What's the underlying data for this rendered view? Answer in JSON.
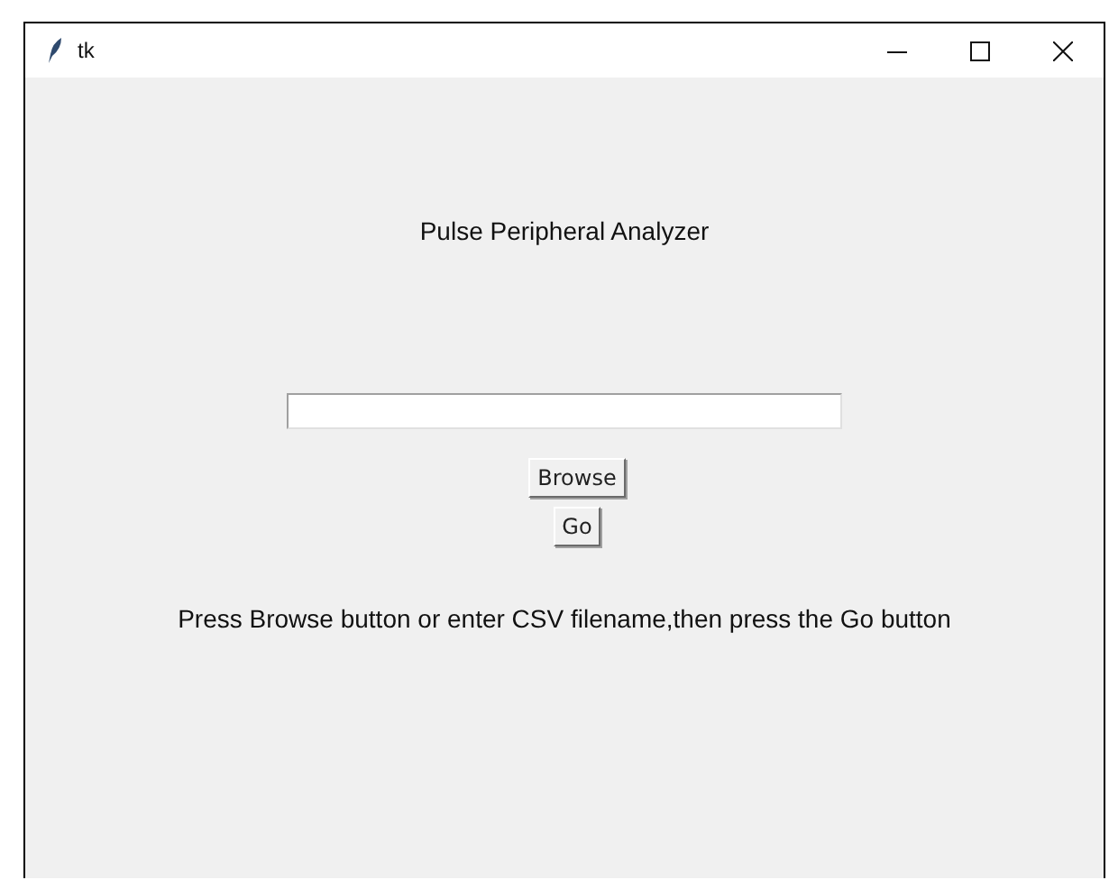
{
  "window": {
    "title": "tk"
  },
  "heading": "Pulse Peripheral Analyzer",
  "buttons": [
    "Browse",
    "Go"
  ],
  "instructions": "Press Browse button or enter CSV filename,then press the Go button"
}
